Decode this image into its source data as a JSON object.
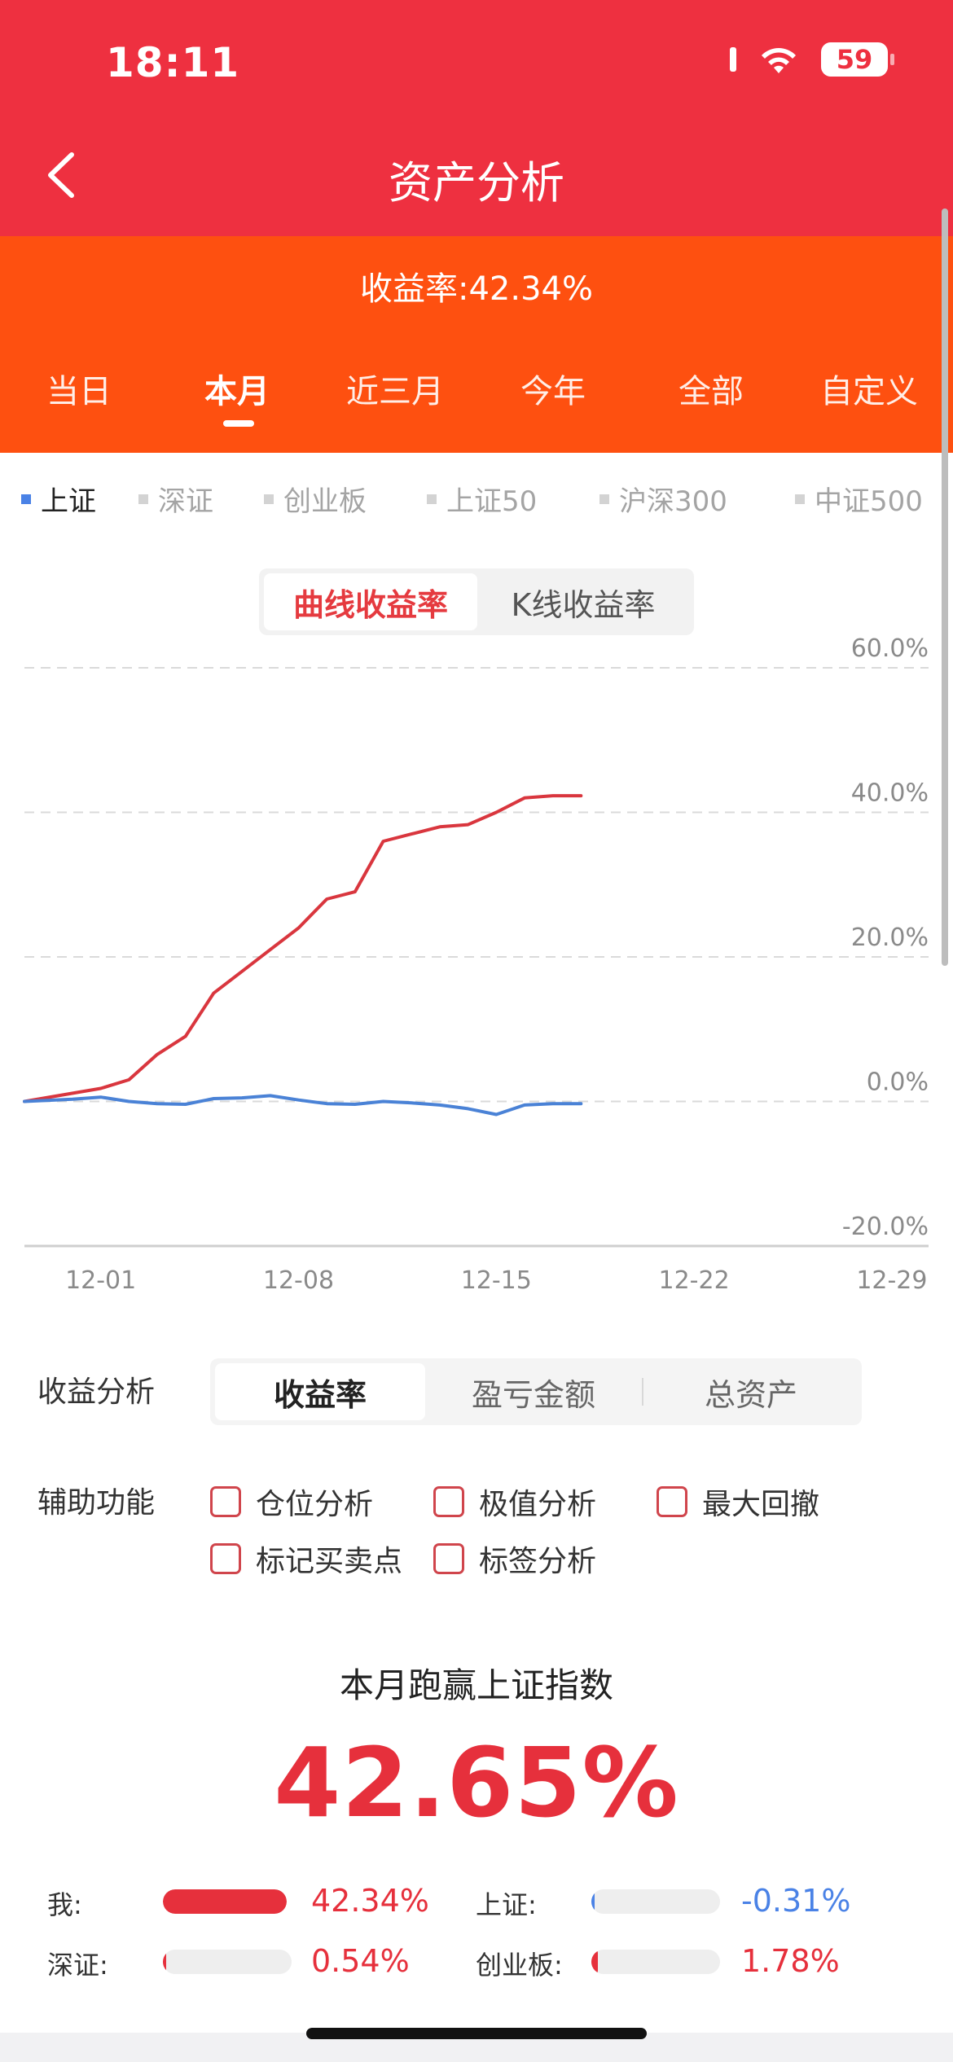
{
  "status": {
    "time": "18:11",
    "battery": "59"
  },
  "nav": {
    "title": "资产分析"
  },
  "summary": {
    "yield_text": "收益率:42.34%"
  },
  "periods": [
    "当日",
    "本月",
    "近三月",
    "今年",
    "全部",
    "自定义"
  ],
  "active_period": "本月",
  "indices": [
    "上证",
    "深证",
    "创业板",
    "上证50",
    "沪深300",
    "中证500"
  ],
  "active_index": "上证",
  "chart_mode": {
    "options": [
      "曲线收益率",
      "K线收益率"
    ],
    "active": "曲线收益率"
  },
  "chart_data": {
    "type": "line",
    "x_ticks": [
      "12-01",
      "12-08",
      "12-15",
      "12-22",
      "12-29"
    ],
    "y_ticks": [
      "60.0%",
      "40.0%",
      "20.0%",
      "0.0%",
      "-20.0%"
    ],
    "ylim": [
      -20,
      60
    ],
    "xlim": [
      -2.7,
      29.3
    ],
    "grid": true,
    "series": [
      {
        "color": "#d9363e",
        "x": [
          -2.7,
          0,
          1,
          2,
          3,
          4,
          5,
          6,
          7,
          8,
          9,
          10,
          11,
          12,
          13,
          14,
          15,
          16,
          17
        ],
        "y": [
          0,
          1.8,
          3.0,
          6.5,
          9.0,
          15.0,
          18.0,
          21.0,
          24.0,
          28.0,
          29.0,
          36.0,
          37.0,
          38.0,
          38.3,
          40.0,
          42.0,
          42.3,
          42.3
        ]
      },
      {
        "color": "#4a82d6",
        "x": [
          -2.7,
          -1,
          0,
          1,
          2,
          3,
          4,
          5,
          6,
          7,
          8,
          9,
          10,
          11,
          12,
          13,
          14,
          15,
          16,
          17
        ],
        "y": [
          0,
          0.3,
          0.6,
          0.0,
          -0.3,
          -0.4,
          0.4,
          0.5,
          0.8,
          0.2,
          -0.3,
          -0.4,
          0.0,
          -0.2,
          -0.5,
          -1.0,
          -1.8,
          -0.5,
          -0.3,
          -0.31
        ]
      }
    ]
  },
  "analysis": {
    "label": "收益分析",
    "options": [
      "收益率",
      "盈亏金额",
      "总资产"
    ],
    "active": "收益率"
  },
  "aux": {
    "label": "辅助功能",
    "options": [
      "仓位分析",
      "极值分析",
      "最大回撤",
      "标记买卖点",
      "标签分析"
    ]
  },
  "comparison": {
    "title": "本月跑赢上证指数",
    "value": "42.65%",
    "items": [
      {
        "label": "我:",
        "value": "42.34%",
        "fill": 1.0,
        "color": "#e6303c"
      },
      {
        "label": "上证:",
        "value": "-0.31%",
        "fill": 0.01,
        "color": "#4a82e6"
      },
      {
        "label": "深证:",
        "value": "0.54%",
        "fill": 0.015,
        "color": "#e6303c"
      },
      {
        "label": "创业板:",
        "value": "1.78%",
        "fill": 0.05,
        "color": "#e6303c"
      }
    ]
  }
}
